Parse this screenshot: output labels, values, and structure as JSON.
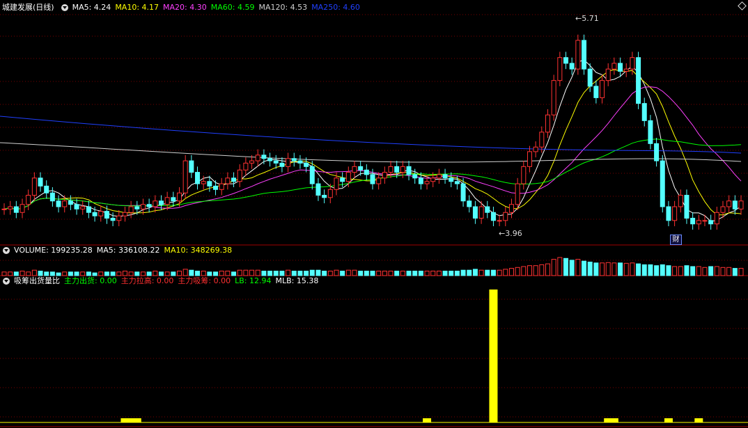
{
  "main_panel": {
    "title": "城建发展(日线)",
    "indicators": [
      {
        "label": "MA5: 4.24",
        "color": "#ffffff"
      },
      {
        "label": "MA10: 4.17",
        "color": "#ffff00"
      },
      {
        "label": "MA20: 4.30",
        "color": "#ff40ff"
      },
      {
        "label": "MA60: 4.59",
        "color": "#00ff00"
      },
      {
        "label": "MA120: 4.53",
        "color": "#d0d0d0"
      },
      {
        "label": "MA250: 4.60",
        "color": "#2040ff"
      }
    ],
    "high_label": "5.71",
    "low_label": "3.96",
    "event_badge": "财"
  },
  "volume_panel": {
    "title": "VOLUME: 199235.28",
    "indicators": [
      {
        "label": "MA5: 336108.22",
        "color": "#ffffff"
      },
      {
        "label": "MA10: 348269.38",
        "color": "#ffff00"
      }
    ]
  },
  "indicator_panel": {
    "title": "吸筹出货量比",
    "indicators": [
      {
        "label": "主力出货: 0.00",
        "color": "#00ff00"
      },
      {
        "label": "主力拉高: 0.00",
        "color": "#ff3030"
      },
      {
        "label": "主力吸筹: 0.00",
        "color": "#ff3030"
      },
      {
        "label": "LB: 12.94",
        "color": "#00ff00"
      },
      {
        "label": "MLB: 15.38",
        "color": "#ffffff"
      }
    ]
  },
  "chart_data": {
    "type": "candlestick",
    "price_high": 5.71,
    "price_low": 3.96,
    "colors": {
      "up": "#ff3232",
      "down": "#54ffff",
      "grid": "#7a0000",
      "spike": "#ffff00"
    },
    "closes": [
      4.08,
      4.1,
      4.05,
      4.12,
      4.2,
      4.35,
      4.28,
      4.22,
      4.15,
      4.1,
      4.15,
      4.12,
      4.08,
      4.1,
      4.05,
      4.02,
      4.06,
      4.0,
      3.98,
      4.02,
      4.05,
      4.1,
      4.08,
      4.12,
      4.1,
      4.15,
      4.12,
      4.18,
      4.15,
      4.22,
      4.5,
      4.4,
      4.3,
      4.32,
      4.28,
      4.25,
      4.3,
      4.35,
      4.32,
      4.42,
      4.48,
      4.5,
      4.55,
      4.52,
      4.5,
      4.48,
      4.45,
      4.52,
      4.5,
      4.48,
      4.45,
      4.3,
      4.2,
      4.18,
      4.25,
      4.35,
      4.32,
      4.4,
      4.45,
      4.42,
      4.38,
      4.3,
      4.35,
      4.4,
      4.45,
      4.4,
      4.45,
      4.38,
      4.35,
      4.3,
      4.32,
      4.35,
      4.38,
      4.35,
      4.32,
      4.3,
      4.15,
      4.1,
      4.0,
      4.1,
      4.05,
      3.98,
      3.98,
      4.05,
      4.12,
      4.3,
      4.45,
      4.58,
      4.62,
      4.75,
      4.9,
      5.2,
      5.4,
      5.35,
      5.3,
      5.55,
      5.3,
      5.15,
      5.05,
      5.2,
      5.3,
      5.35,
      5.28,
      5.3,
      5.4,
      5.0,
      4.85,
      4.65,
      4.5,
      4.1,
      3.98,
      4.1,
      4.2,
      4.0,
      3.95,
      3.98,
      3.98,
      3.95,
      4.05,
      4.1,
      4.15,
      4.08,
      4.15
    ],
    "volume": [
      0.2,
      0.2,
      0.2,
      0.25,
      0.2,
      0.3,
      0.25,
      0.2,
      0.2,
      0.15,
      0.2,
      0.2,
      0.2,
      0.2,
      0.2,
      0.15,
      0.2,
      0.2,
      0.2,
      0.2,
      0.25,
      0.2,
      0.2,
      0.2,
      0.2,
      0.25,
      0.2,
      0.2,
      0.2,
      0.25,
      0.35,
      0.3,
      0.25,
      0.25,
      0.2,
      0.2,
      0.25,
      0.25,
      0.2,
      0.3,
      0.3,
      0.3,
      0.3,
      0.25,
      0.25,
      0.25,
      0.25,
      0.3,
      0.25,
      0.25,
      0.25,
      0.3,
      0.3,
      0.25,
      0.25,
      0.3,
      0.25,
      0.3,
      0.3,
      0.25,
      0.25,
      0.25,
      0.25,
      0.25,
      0.25,
      0.25,
      0.25,
      0.25,
      0.25,
      0.25,
      0.25,
      0.25,
      0.25,
      0.25,
      0.25,
      0.25,
      0.3,
      0.3,
      0.35,
      0.3,
      0.3,
      0.3,
      0.3,
      0.35,
      0.4,
      0.45,
      0.5,
      0.55,
      0.55,
      0.6,
      0.65,
      0.9,
      1.0,
      0.95,
      0.85,
      0.9,
      0.8,
      0.75,
      0.7,
      0.7,
      0.72,
      0.7,
      0.7,
      0.68,
      0.7,
      0.65,
      0.6,
      0.6,
      0.55,
      0.6,
      0.55,
      0.5,
      0.5,
      0.55,
      0.5,
      0.5,
      0.45,
      0.5,
      0.5,
      0.45,
      0.45,
      0.4,
      0.4
    ],
    "indicator_spike_index": 81
  }
}
